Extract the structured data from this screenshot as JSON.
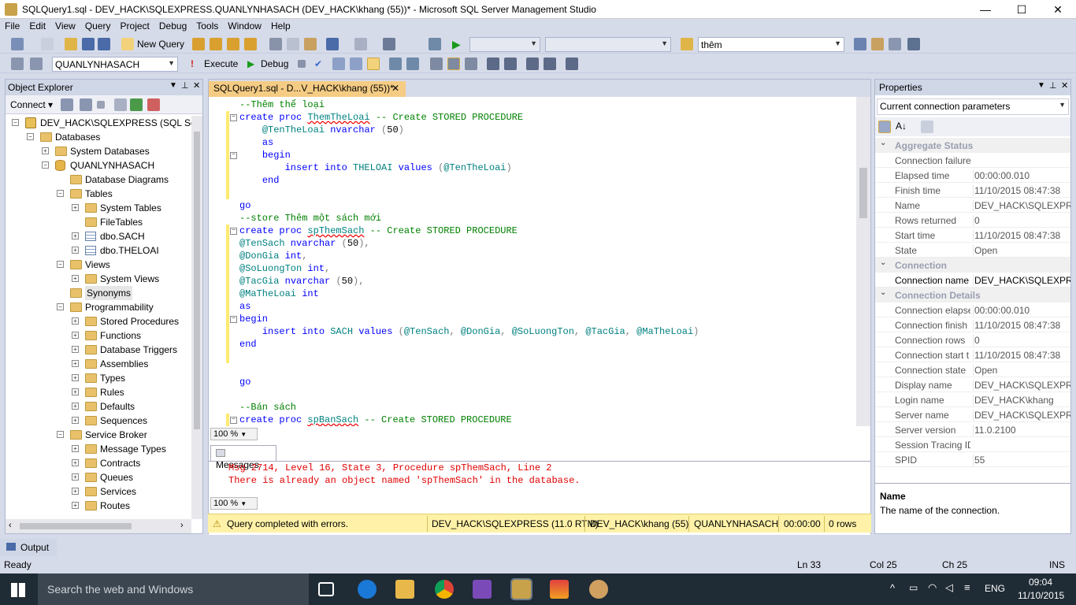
{
  "window": {
    "title": "SQLQuery1.sql - DEV_HACK\\SQLEXPRESS.QUANLYNHASACH (DEV_HACK\\khang (55))* - Microsoft SQL Server Management Studio",
    "min": "—",
    "max": "☐",
    "close": "✕"
  },
  "menu": [
    "File",
    "Edit",
    "View",
    "Query",
    "Project",
    "Debug",
    "Tools",
    "Window",
    "Help"
  ],
  "toolbar1": {
    "new_query": "New Query",
    "search_combo": "thêm"
  },
  "toolbar2": {
    "database": "QUANLYNHASACH",
    "execute": "Execute",
    "debug": "Debug"
  },
  "object_explorer": {
    "title": "Object Explorer",
    "connect": "Connect",
    "tree": [
      {
        "label": "DEV_HACK\\SQLEXPRESS (SQL Serve",
        "exp": "⊟",
        "icon": "server-icon",
        "level": 0
      },
      {
        "label": "Databases",
        "exp": "⊟",
        "icon": "folder-icon",
        "level": 1
      },
      {
        "label": "System Databases",
        "exp": "⊞",
        "icon": "folder-icon",
        "level": 2
      },
      {
        "label": "QUANLYNHASACH",
        "exp": "⊟",
        "icon": "database-icon",
        "level": 2
      },
      {
        "label": "Database Diagrams",
        "exp": "",
        "icon": "folder-icon",
        "level": 3
      },
      {
        "label": "Tables",
        "exp": "⊟",
        "icon": "folder-icon",
        "level": 3
      },
      {
        "label": "System Tables",
        "exp": "⊞",
        "icon": "folder-icon",
        "level": 4
      },
      {
        "label": "FileTables",
        "exp": "",
        "icon": "folder-icon",
        "level": 4
      },
      {
        "label": "dbo.SACH",
        "exp": "⊞",
        "icon": "table-icon",
        "level": 4
      },
      {
        "label": "dbo.THELOAI",
        "exp": "⊞",
        "icon": "table-icon",
        "level": 4
      },
      {
        "label": "Views",
        "exp": "⊟",
        "icon": "folder-icon",
        "level": 3
      },
      {
        "label": "System Views",
        "exp": "⊞",
        "icon": "folder-icon",
        "level": 4
      },
      {
        "label": "Synonyms",
        "exp": "",
        "icon": "folder-icon",
        "level": 3
      },
      {
        "label": "Programmability",
        "exp": "⊟",
        "icon": "folder-icon",
        "level": 3
      },
      {
        "label": "Stored Procedures",
        "exp": "⊞",
        "icon": "folder-icon",
        "level": 4
      },
      {
        "label": "Functions",
        "exp": "⊞",
        "icon": "folder-icon",
        "level": 4
      },
      {
        "label": "Database Triggers",
        "exp": "⊞",
        "icon": "folder-icon",
        "level": 4
      },
      {
        "label": "Assemblies",
        "exp": "⊞",
        "icon": "folder-icon",
        "level": 4
      },
      {
        "label": "Types",
        "exp": "⊞",
        "icon": "folder-icon",
        "level": 4
      },
      {
        "label": "Rules",
        "exp": "⊞",
        "icon": "folder-icon",
        "level": 4
      },
      {
        "label": "Defaults",
        "exp": "⊞",
        "icon": "folder-icon",
        "level": 4
      },
      {
        "label": "Sequences",
        "exp": "⊞",
        "icon": "folder-icon",
        "level": 4
      },
      {
        "label": "Service Broker",
        "exp": "⊟",
        "icon": "folder-icon",
        "level": 3
      },
      {
        "label": "Message Types",
        "exp": "⊞",
        "icon": "folder-icon",
        "level": 4
      },
      {
        "label": "Contracts",
        "exp": "⊞",
        "icon": "folder-icon",
        "level": 4
      },
      {
        "label": "Queues",
        "exp": "⊞",
        "icon": "folder-icon",
        "level": 4
      },
      {
        "label": "Services",
        "exp": "⊞",
        "icon": "folder-icon",
        "level": 4
      },
      {
        "label": "Routes",
        "exp": "⊞",
        "icon": "folder-icon",
        "level": 4
      }
    ]
  },
  "editor": {
    "tab_title": "SQLQuery1.sql - D...V_HACK\\khang (55))*",
    "tab_close": "✕",
    "zoom": "100 %",
    "lines": [
      [
        [
          "cm",
          "--Thêm thể loại"
        ]
      ],
      [
        [
          "kw",
          "create proc "
        ],
        [
          "id sq",
          "ThemTheLoai"
        ],
        [
          "cm",
          " -- Create STORED PROCEDURE"
        ]
      ],
      [
        [
          "",
          "    "
        ],
        [
          "id",
          "@TenTheLoai"
        ],
        [
          "kw",
          " nvarchar "
        ],
        [
          "gr",
          "("
        ],
        [
          "",
          "50"
        ],
        [
          "gr",
          ")"
        ]
      ],
      [
        [
          "",
          "    "
        ],
        [
          "kw",
          "as"
        ]
      ],
      [
        [
          "",
          "    "
        ],
        [
          "kw",
          "begin"
        ]
      ],
      [
        [
          "",
          "        "
        ],
        [
          "kw",
          "insert into "
        ],
        [
          "id",
          "THELOAI"
        ],
        [
          "kw",
          " values "
        ],
        [
          "gr",
          "("
        ],
        [
          "id",
          "@TenTheLoai"
        ],
        [
          "gr",
          ")"
        ]
      ],
      [
        [
          "",
          "    "
        ],
        [
          "kw",
          "end"
        ]
      ],
      [],
      [
        [
          "kw",
          "go"
        ]
      ],
      [
        [
          "cm",
          "--store Thêm một sách mới"
        ]
      ],
      [
        [
          "kw",
          "create proc "
        ],
        [
          "id sq",
          "spThemSach"
        ],
        [
          "cm",
          " -- Create STORED PROCEDURE"
        ]
      ],
      [
        [
          "id",
          "@TenSach"
        ],
        [
          "kw",
          " nvarchar "
        ],
        [
          "gr",
          "("
        ],
        [
          "",
          "50"
        ],
        [
          "gr",
          "),"
        ]
      ],
      [
        [
          "id",
          "@DonGia"
        ],
        [
          "kw",
          " int"
        ],
        [
          "gr",
          ","
        ]
      ],
      [
        [
          "id",
          "@SoLuongTon"
        ],
        [
          "kw",
          " int"
        ],
        [
          "gr",
          ","
        ]
      ],
      [
        [
          "id",
          "@TacGia"
        ],
        [
          "kw",
          " nvarchar "
        ],
        [
          "gr",
          "("
        ],
        [
          "",
          "50"
        ],
        [
          "gr",
          "),"
        ]
      ],
      [
        [
          "id",
          "@MaTheLoai"
        ],
        [
          "kw",
          " int"
        ]
      ],
      [
        [
          "kw",
          "as"
        ]
      ],
      [
        [
          "kw",
          "begin"
        ]
      ],
      [
        [
          "",
          "    "
        ],
        [
          "kw",
          "insert into "
        ],
        [
          "id",
          "SACH"
        ],
        [
          "kw",
          " values "
        ],
        [
          "gr",
          "("
        ],
        [
          "id",
          "@TenSach"
        ],
        [
          "gr",
          ", "
        ],
        [
          "id",
          "@DonGia"
        ],
        [
          "gr",
          ", "
        ],
        [
          "id",
          "@SoLuongTon"
        ],
        [
          "gr",
          ", "
        ],
        [
          "id",
          "@TacGia"
        ],
        [
          "gr",
          ", "
        ],
        [
          "id",
          "@MaTheLoai"
        ],
        [
          "gr",
          ")"
        ]
      ],
      [
        [
          "kw",
          "end"
        ]
      ],
      [],
      [],
      [
        [
          "kw",
          "go"
        ]
      ],
      [],
      [
        [
          "cm",
          "--Bán sách"
        ]
      ],
      [
        [
          "kw",
          "create proc "
        ],
        [
          "id sq",
          "spBanSach"
        ],
        [
          "cm",
          " -- Create STORED PROCEDURE"
        ]
      ]
    ]
  },
  "messages": {
    "tab": "Messages",
    "zoom": "100 %",
    "lines": [
      "Msg 2714, Level 16, State 3, Procedure spThemSach, Line 2",
      "There is already an object named 'spThemSach' in the database."
    ]
  },
  "query_status": {
    "text": "Query completed with errors.",
    "server": "DEV_HACK\\SQLEXPRESS (11.0 RTM)",
    "user": "DEV_HACK\\khang (55)",
    "db": "QUANLYNHASACH",
    "time": "00:00:00",
    "rows": "0 rows"
  },
  "properties": {
    "title": "Properties",
    "object": "Current connection parameters",
    "rows": [
      {
        "cat": true,
        "k": "Aggregate Status"
      },
      {
        "k": "Connection failure",
        "v": ""
      },
      {
        "k": "Elapsed time",
        "v": "00:00:00.010"
      },
      {
        "k": "Finish time",
        "v": "11/10/2015 08:47:38"
      },
      {
        "k": "Name",
        "v": "DEV_HACK\\SQLEXPRESS"
      },
      {
        "k": "Rows returned",
        "v": "0"
      },
      {
        "k": "Start time",
        "v": "11/10/2015 08:47:38"
      },
      {
        "k": "State",
        "v": "Open"
      },
      {
        "cat": true,
        "k": "Connection"
      },
      {
        "k": "Connection name",
        "v": "DEV_HACK\\SQLEXPRESS",
        "dark": true
      },
      {
        "cat": true,
        "k": "Connection Details"
      },
      {
        "k": "Connection elapsed",
        "v": "00:00:00.010"
      },
      {
        "k": "Connection finish",
        "v": "11/10/2015 08:47:38"
      },
      {
        "k": "Connection rows",
        "v": "0"
      },
      {
        "k": "Connection start t",
        "v": "11/10/2015 08:47:38"
      },
      {
        "k": "Connection state",
        "v": "Open"
      },
      {
        "k": "Display name",
        "v": "DEV_HACK\\SQLEXPRESS"
      },
      {
        "k": "Login name",
        "v": "DEV_HACK\\khang"
      },
      {
        "k": "Server name",
        "v": "DEV_HACK\\SQLEXPRESS"
      },
      {
        "k": "Server version",
        "v": "11.0.2100"
      },
      {
        "k": "Session Tracing ID",
        "v": ""
      },
      {
        "k": "SPID",
        "v": "55"
      }
    ],
    "desc_title": "Name",
    "desc_text": "The name of the connection."
  },
  "output": {
    "label": "Output"
  },
  "statusbar": {
    "ready": "Ready",
    "ln": "Ln 33",
    "col": "Col 25",
    "ch": "Ch 25",
    "ins": "INS"
  },
  "taskbar": {
    "search": "Search the web and Windows",
    "lang": "ENG",
    "time": "09:04",
    "date": "11/10/2015"
  }
}
